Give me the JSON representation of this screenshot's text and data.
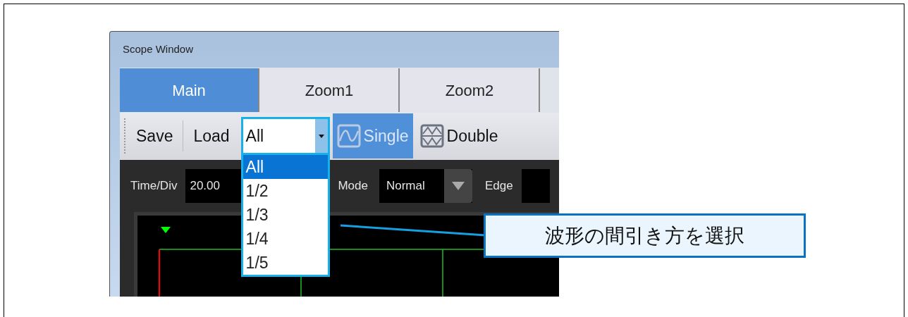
{
  "window": {
    "title": "Scope Window"
  },
  "tabs": [
    {
      "label": "Main",
      "selected": true
    },
    {
      "label": "Zoom1",
      "selected": false
    },
    {
      "label": "Zoom2",
      "selected": false
    }
  ],
  "toolbar": {
    "buttons": [
      {
        "label": "Save"
      },
      {
        "label": "Load"
      }
    ],
    "decimation": {
      "value": "All",
      "expanded": true,
      "options": [
        {
          "label": "All",
          "selected": true
        },
        {
          "label": "1/2",
          "selected": false
        },
        {
          "label": "1/3",
          "selected": false
        },
        {
          "label": "1/4",
          "selected": false
        },
        {
          "label": "1/5",
          "selected": false
        }
      ]
    },
    "view_buttons": [
      {
        "kind": "single",
        "label": "Single",
        "selected": true,
        "disabled": true
      },
      {
        "kind": "double",
        "label": "Double",
        "selected": false,
        "disabled": false
      }
    ]
  },
  "params": {
    "time_div": {
      "label": "Time/Div",
      "value": "20.00"
    },
    "mode": {
      "label": "Mode",
      "value": "Normal"
    },
    "edge": {
      "label": "Edge"
    }
  },
  "callout": {
    "text": "波形の間引き方を選択"
  }
}
